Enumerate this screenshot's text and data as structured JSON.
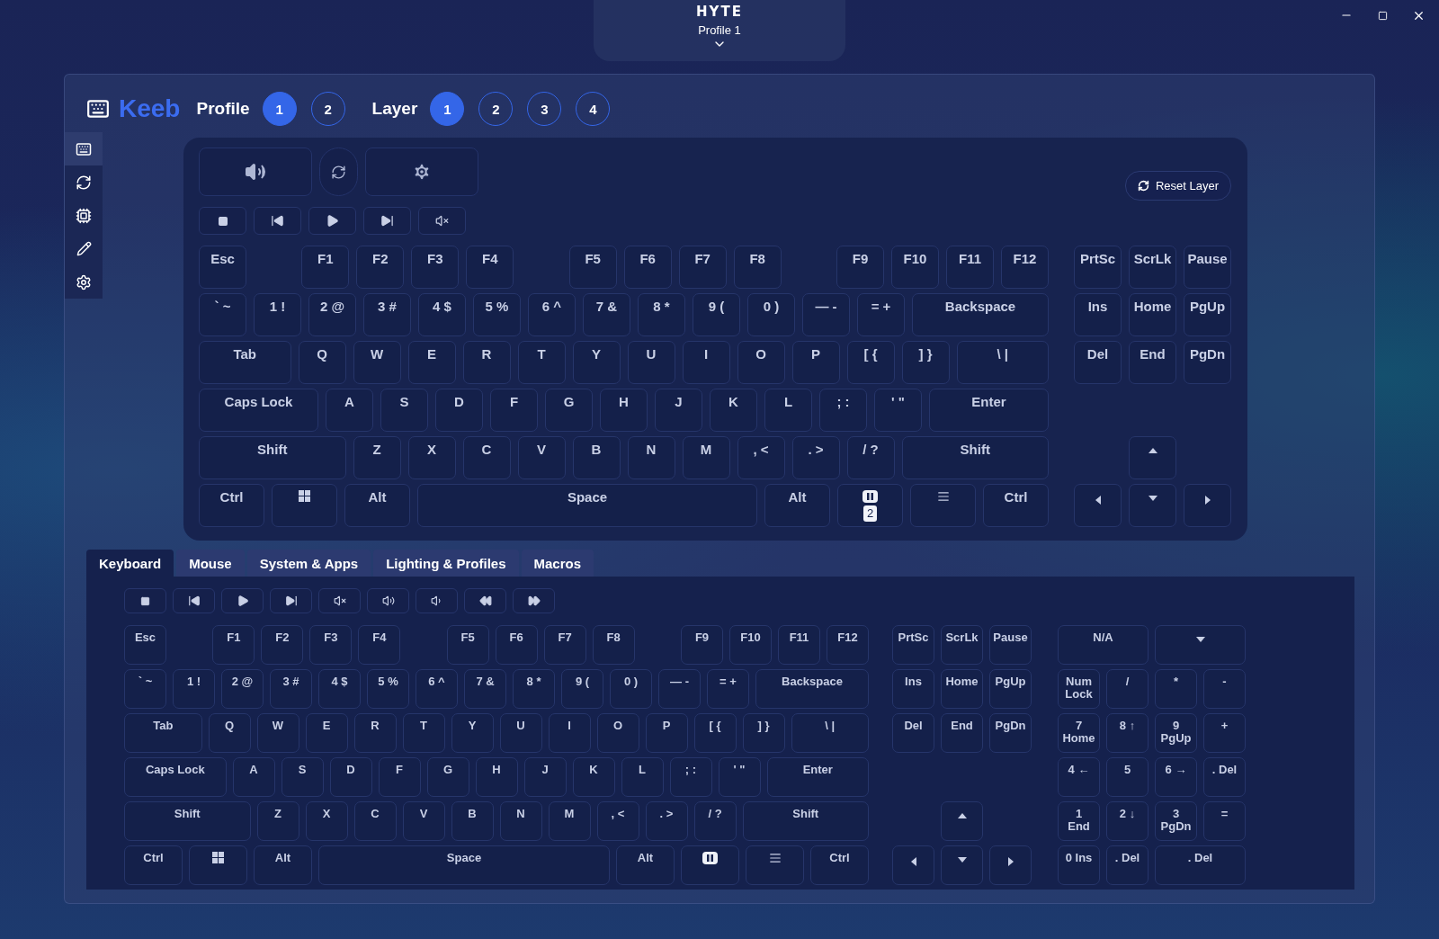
{
  "titlebar": {
    "logo": "HYTE",
    "profile": "Profile 1"
  },
  "header": {
    "app_name": "Keeb",
    "profile_label": "Profile",
    "profiles": [
      {
        "label": "1",
        "selected": true
      },
      {
        "label": "2",
        "selected": false
      }
    ],
    "layer_label": "Layer",
    "layers": [
      {
        "label": "1",
        "selected": true
      },
      {
        "label": "2",
        "selected": false
      },
      {
        "label": "3",
        "selected": false
      },
      {
        "label": "4",
        "selected": false
      }
    ]
  },
  "sidebar": {
    "items": [
      {
        "kind": "keyboard",
        "selected": true
      },
      {
        "kind": "sync",
        "selected": false
      },
      {
        "kind": "chip",
        "selected": false
      },
      {
        "kind": "pencil",
        "selected": false
      },
      {
        "kind": "settings",
        "selected": false
      }
    ]
  },
  "layer_keyboard": {
    "tiles": [
      {
        "kind": "volume"
      },
      {
        "kind": "sync"
      },
      {
        "kind": "settings"
      }
    ],
    "media": [
      {
        "kind": "stop"
      },
      {
        "kind": "prev"
      },
      {
        "kind": "play"
      },
      {
        "kind": "next"
      },
      {
        "kind": "mute"
      }
    ],
    "reset_button": "Reset Layer",
    "function_row": [
      {
        "keys": [
          "Esc"
        ]
      },
      {
        "keys": [
          "F1",
          "F2",
          "F3",
          "F4"
        ]
      },
      {
        "keys": [
          "F5",
          "F6",
          "F7",
          "F8"
        ]
      },
      {
        "keys": [
          "F9",
          "F10",
          "F11",
          "F12"
        ]
      }
    ],
    "rows": [
      {
        "keys": [
          {
            "label": "` ~",
            "kind": "key"
          },
          {
            "label": "1 !",
            "kind": "key"
          },
          {
            "label": "2 @",
            "kind": "key"
          },
          {
            "label": "3 #",
            "kind": "key"
          },
          {
            "label": "4 $",
            "kind": "key"
          },
          {
            "label": "5 %",
            "kind": "key"
          },
          {
            "label": "6 ^",
            "kind": "key"
          },
          {
            "label": "7 &",
            "kind": "key"
          },
          {
            "label": "8 *",
            "kind": "key"
          },
          {
            "label": "9 (",
            "kind": "key"
          },
          {
            "label": "0 )",
            "kind": "key"
          },
          {
            "label": "— -",
            "kind": "key"
          },
          {
            "label": "= +",
            "kind": "key"
          },
          {
            "label": "Backspace",
            "kind": "wide"
          }
        ]
      },
      {
        "keys": [
          {
            "label": "Tab",
            "kind": "wide"
          },
          {
            "label": "Q",
            "kind": "key"
          },
          {
            "label": "W",
            "kind": "key"
          },
          {
            "label": "E",
            "kind": "key"
          },
          {
            "label": "R",
            "kind": "key"
          },
          {
            "label": "T",
            "kind": "key"
          },
          {
            "label": "Y",
            "kind": "key"
          },
          {
            "label": "U",
            "kind": "key"
          },
          {
            "label": "I",
            "kind": "key"
          },
          {
            "label": "O",
            "kind": "key"
          },
          {
            "label": "P",
            "kind": "key"
          },
          {
            "label": "[ {",
            "kind": "key"
          },
          {
            "label": "] }",
            "kind": "key"
          },
          {
            "label": "\\ |",
            "kind": "wide"
          }
        ]
      },
      {
        "keys": [
          {
            "label": "Caps Lock",
            "kind": "wide"
          },
          {
            "label": "A",
            "kind": "key"
          },
          {
            "label": "S",
            "kind": "key"
          },
          {
            "label": "D",
            "kind": "key"
          },
          {
            "label": "F",
            "kind": "key"
          },
          {
            "label": "G",
            "kind": "key"
          },
          {
            "label": "H",
            "kind": "key"
          },
          {
            "label": "J",
            "kind": "key"
          },
          {
            "label": "K",
            "kind": "key"
          },
          {
            "label": "L",
            "kind": "key"
          },
          {
            "label": "; :",
            "kind": "key"
          },
          {
            "label": "' \"",
            "kind": "key"
          },
          {
            "label": "Enter",
            "kind": "wide"
          }
        ]
      },
      {
        "keys": [
          {
            "label": "Shift",
            "kind": "wide"
          },
          {
            "label": "Z",
            "kind": "key"
          },
          {
            "label": "X",
            "kind": "key"
          },
          {
            "label": "C",
            "kind": "key"
          },
          {
            "label": "V",
            "kind": "key"
          },
          {
            "label": "B",
            "kind": "key"
          },
          {
            "label": "N",
            "kind": "key"
          },
          {
            "label": "M",
            "kind": "key"
          },
          {
            "label": ", <",
            "kind": "key"
          },
          {
            "label": ". >",
            "kind": "key"
          },
          {
            "label": "/ ?",
            "kind": "key"
          },
          {
            "label": "Shift",
            "kind": "wide"
          }
        ]
      },
      {
        "keys": [
          {
            "label": "Ctrl",
            "kind": "mod"
          },
          {
            "kind": "windows"
          },
          {
            "label": "Alt",
            "kind": "mod"
          },
          {
            "label": "Space",
            "kind": "wide"
          },
          {
            "label": "Alt",
            "kind": "mod"
          },
          {
            "kind": "fn",
            "badge": "2"
          },
          {
            "kind": "menu"
          },
          {
            "label": "Ctrl",
            "kind": "mod"
          }
        ]
      }
    ],
    "nav": {
      "top_rows": [
        {
          "keys": [
            "PrtSc",
            "ScrLk",
            "Pause"
          ]
        },
        {
          "keys": [
            "Ins",
            "Home",
            "PgUp"
          ]
        },
        {
          "keys": [
            "Del",
            "End",
            "PgDn"
          ]
        }
      ],
      "arrow_rows": [
        {
          "keys": [
            {
              "kind": "up"
            }
          ]
        },
        {
          "keys": [
            {
              "kind": "left"
            },
            {
              "kind": "down"
            },
            {
              "kind": "right"
            }
          ]
        }
      ]
    }
  },
  "tabs": [
    {
      "label": "Keyboard",
      "selected": true
    },
    {
      "label": "Mouse",
      "selected": false
    },
    {
      "label": "System & Apps",
      "selected": false
    },
    {
      "label": "Lighting & Profiles",
      "selected": false
    },
    {
      "label": "Macros",
      "selected": false
    }
  ],
  "key_palette": {
    "media": [
      {
        "kind": "stop"
      },
      {
        "kind": "prev"
      },
      {
        "kind": "play"
      },
      {
        "kind": "next"
      },
      {
        "kind": "mute"
      },
      {
        "kind": "volup"
      },
      {
        "kind": "voldown"
      },
      {
        "kind": "rewind"
      },
      {
        "kind": "forward"
      }
    ],
    "function_row": [
      {
        "keys": [
          "Esc"
        ]
      },
      {
        "keys": [
          "F1",
          "F2",
          "F3",
          "F4"
        ]
      },
      {
        "keys": [
          "F5",
          "F6",
          "F7",
          "F8"
        ]
      },
      {
        "keys": [
          "F9",
          "F10",
          "F11",
          "F12"
        ]
      }
    ],
    "rows": [
      {
        "keys": [
          {
            "label": "` ~",
            "kind": "key"
          },
          {
            "label": "1 !",
            "kind": "key"
          },
          {
            "label": "2 @",
            "kind": "key"
          },
          {
            "label": "3 #",
            "kind": "key"
          },
          {
            "label": "4 $",
            "kind": "key"
          },
          {
            "label": "5 %",
            "kind": "key"
          },
          {
            "label": "6 ^",
            "kind": "key"
          },
          {
            "label": "7 &",
            "kind": "key"
          },
          {
            "label": "8 *",
            "kind": "key"
          },
          {
            "label": "9 (",
            "kind": "key"
          },
          {
            "label": "0 )",
            "kind": "key"
          },
          {
            "label": "— -",
            "kind": "key"
          },
          {
            "label": "= +",
            "kind": "key"
          },
          {
            "label": "Backspace",
            "kind": "wide"
          }
        ]
      },
      {
        "keys": [
          {
            "label": "Tab",
            "kind": "wide"
          },
          {
            "label": "Q",
            "kind": "key"
          },
          {
            "label": "W",
            "kind": "key"
          },
          {
            "label": "E",
            "kind": "key"
          },
          {
            "label": "R",
            "kind": "key"
          },
          {
            "label": "T",
            "kind": "key"
          },
          {
            "label": "Y",
            "kind": "key"
          },
          {
            "label": "U",
            "kind": "key"
          },
          {
            "label": "I",
            "kind": "key"
          },
          {
            "label": "O",
            "kind": "key"
          },
          {
            "label": "P",
            "kind": "key"
          },
          {
            "label": "[ {",
            "kind": "key"
          },
          {
            "label": "] }",
            "kind": "key"
          },
          {
            "label": "\\ |",
            "kind": "wide"
          }
        ]
      },
      {
        "keys": [
          {
            "label": "Caps Lock",
            "kind": "wide"
          },
          {
            "label": "A",
            "kind": "key"
          },
          {
            "label": "S",
            "kind": "key"
          },
          {
            "label": "D",
            "kind": "key"
          },
          {
            "label": "F",
            "kind": "key"
          },
          {
            "label": "G",
            "kind": "key"
          },
          {
            "label": "H",
            "kind": "key"
          },
          {
            "label": "J",
            "kind": "key"
          },
          {
            "label": "K",
            "kind": "key"
          },
          {
            "label": "L",
            "kind": "key"
          },
          {
            "label": "; :",
            "kind": "key"
          },
          {
            "label": "' \"",
            "kind": "key"
          },
          {
            "label": "Enter",
            "kind": "wide"
          }
        ]
      },
      {
        "keys": [
          {
            "label": "Shift",
            "kind": "wide"
          },
          {
            "label": "Z",
            "kind": "key"
          },
          {
            "label": "X",
            "kind": "key"
          },
          {
            "label": "C",
            "kind": "key"
          },
          {
            "label": "V",
            "kind": "key"
          },
          {
            "label": "B",
            "kind": "key"
          },
          {
            "label": "N",
            "kind": "key"
          },
          {
            "label": "M",
            "kind": "key"
          },
          {
            "label": ", <",
            "kind": "key"
          },
          {
            "label": ". >",
            "kind": "key"
          },
          {
            "label": "/ ?",
            "kind": "key"
          },
          {
            "label": "Shift",
            "kind": "wide"
          }
        ]
      },
      {
        "keys": [
          {
            "label": "Ctrl",
            "kind": "mod"
          },
          {
            "kind": "windows"
          },
          {
            "label": "Alt",
            "kind": "mod"
          },
          {
            "label": "Space",
            "kind": "wide"
          },
          {
            "label": "Alt",
            "kind": "mod"
          },
          {
            "kind": "fn"
          },
          {
            "kind": "menu"
          },
          {
            "label": "Ctrl",
            "kind": "mod"
          }
        ]
      }
    ],
    "nav": {
      "top_rows": [
        {
          "keys": [
            "PrtSc",
            "ScrLk",
            "Pause"
          ]
        },
        {
          "keys": [
            "Ins",
            "Home",
            "PgUp"
          ]
        },
        {
          "keys": [
            "Del",
            "End",
            "PgDn"
          ]
        }
      ],
      "arrow_rows": [
        {
          "keys": [
            {
              "kind": "up"
            }
          ]
        },
        {
          "keys": [
            {
              "kind": "left"
            },
            {
              "kind": "down"
            },
            {
              "kind": "right"
            }
          ]
        }
      ]
    },
    "numpad": [
      {
        "keys": [
          {
            "label": "N/A",
            "kind": "double"
          },
          {
            "kind": "dropdown"
          }
        ]
      },
      {
        "keys": [
          {
            "label": "Num\nLock",
            "kind": "key"
          },
          {
            "label": "/",
            "kind": "key"
          },
          {
            "label": "*",
            "kind": "key"
          },
          {
            "label": "-",
            "kind": "key"
          }
        ]
      },
      {
        "keys": [
          {
            "label": "7\nHome",
            "kind": "key"
          },
          {
            "label": "8 ↑",
            "kind": "key"
          },
          {
            "label": "9\nPgUp",
            "kind": "key"
          },
          {
            "label": "+",
            "kind": "key"
          }
        ]
      },
      {
        "keys": [
          {
            "label": "4 ←",
            "kind": "key"
          },
          {
            "label": "5",
            "kind": "key"
          },
          {
            "label": "6 →",
            "kind": "key"
          },
          {
            "label": ". Del",
            "kind": "key"
          }
        ]
      },
      {
        "keys": [
          {
            "label": "1\nEnd",
            "kind": "key"
          },
          {
            "label": "2 ↓",
            "kind": "key"
          },
          {
            "label": "3\nPgDn",
            "kind": "key"
          },
          {
            "label": "=",
            "kind": "key"
          }
        ]
      },
      {
        "keys": [
          {
            "label": "0 Ins",
            "kind": "key"
          },
          {
            "label": ". Del",
            "kind": "key"
          },
          {
            "label": ". Del",
            "kind": "double"
          }
        ]
      }
    ]
  }
}
